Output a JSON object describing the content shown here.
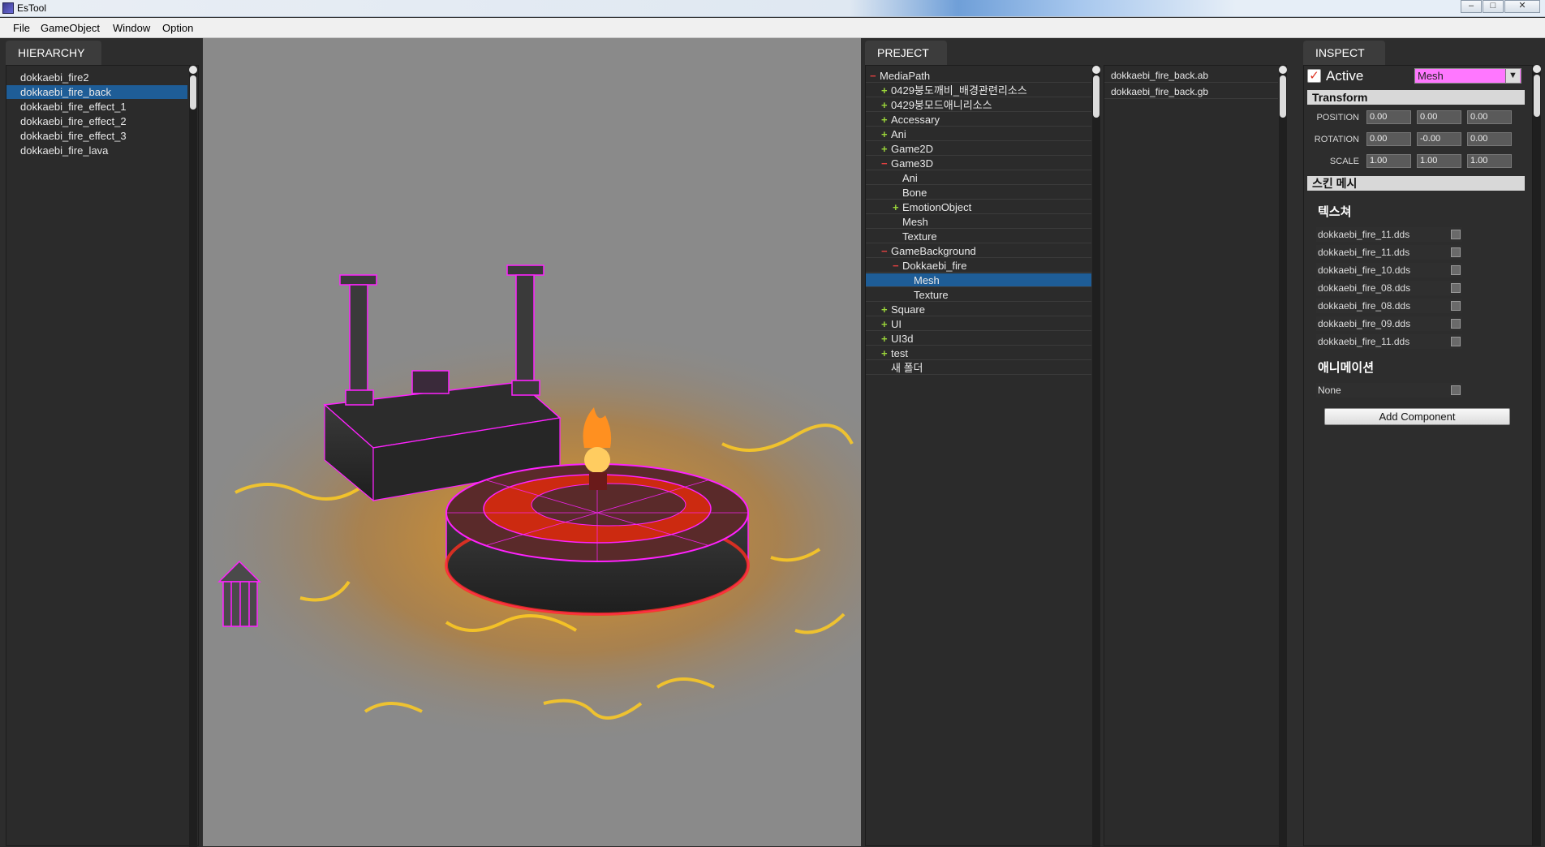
{
  "window": {
    "title": "EsTool",
    "controls": [
      "–",
      "□",
      "✕"
    ]
  },
  "menu": [
    "File",
    "GameObject",
    "Window",
    "Option"
  ],
  "hierarchy": {
    "tab": "HIERARCHY",
    "items": [
      {
        "label": "dokkaebi_fire2",
        "selected": false
      },
      {
        "label": "dokkaebi_fire_back",
        "selected": true
      },
      {
        "label": "dokkaebi_fire_effect_1",
        "selected": false
      },
      {
        "label": "dokkaebi_fire_effect_2",
        "selected": false
      },
      {
        "label": "dokkaebi_fire_effect_3",
        "selected": false
      },
      {
        "label": "dokkaebi_fire_lava",
        "selected": false
      }
    ]
  },
  "project": {
    "tab": "PREJECT",
    "tree": [
      {
        "label": "MediaPath",
        "marker": "minus",
        "depth": 0
      },
      {
        "label": "0429붕도깨비_배경관련리소스",
        "marker": "plus",
        "depth": 1
      },
      {
        "label": "0429붕모드애니리소스",
        "marker": "plus",
        "depth": 1
      },
      {
        "label": "Accessary",
        "marker": "plus",
        "depth": 1
      },
      {
        "label": "Ani",
        "marker": "plus",
        "depth": 1
      },
      {
        "label": "Game2D",
        "marker": "plus",
        "depth": 1
      },
      {
        "label": "Game3D",
        "marker": "minus",
        "depth": 1
      },
      {
        "label": "Ani",
        "marker": "",
        "depth": 2
      },
      {
        "label": "Bone",
        "marker": "",
        "depth": 2
      },
      {
        "label": "EmotionObject",
        "marker": "plus",
        "depth": 2
      },
      {
        "label": "Mesh",
        "marker": "",
        "depth": 2
      },
      {
        "label": "Texture",
        "marker": "",
        "depth": 2
      },
      {
        "label": "GameBackground",
        "marker": "minus",
        "depth": 1
      },
      {
        "label": "Dokkaebi_fire",
        "marker": "minus",
        "depth": 2
      },
      {
        "label": "Mesh",
        "marker": "",
        "depth": 3,
        "selected": true
      },
      {
        "label": "Texture",
        "marker": "",
        "depth": 3
      },
      {
        "label": "Square",
        "marker": "plus",
        "depth": 1
      },
      {
        "label": "UI",
        "marker": "plus",
        "depth": 1
      },
      {
        "label": "UI3d",
        "marker": "plus",
        "depth": 1
      },
      {
        "label": "test",
        "marker": "plus",
        "depth": 1
      },
      {
        "label": "새 폴더",
        "marker": "",
        "depth": 1
      }
    ],
    "files": [
      "dokkaebi_fire_back.ab",
      "dokkaebi_fire_back.gb"
    ]
  },
  "inspect": {
    "tab": "INSPECT",
    "active_label": "Active",
    "active_checked": true,
    "type_value": "Mesh",
    "transform_header": "Transform",
    "rows": [
      {
        "label": "POSITION",
        "values": [
          "0.00",
          "0.00",
          "0.00"
        ]
      },
      {
        "label": "ROTATION",
        "values": [
          "0.00",
          "-0.00",
          "0.00"
        ]
      },
      {
        "label": "SCALE",
        "values": [
          "1.00",
          "1.00",
          "1.00"
        ]
      }
    ],
    "skin_header": "스킨 메시",
    "texture_title": "텍스쳐",
    "textures": [
      "dokkaebi_fire_11.dds",
      "dokkaebi_fire_11.dds",
      "dokkaebi_fire_10.dds",
      "dokkaebi_fire_08.dds",
      "dokkaebi_fire_08.dds",
      "dokkaebi_fire_09.dds",
      "dokkaebi_fire_11.dds"
    ],
    "animation_title": "애니메이션",
    "animation_value": "None",
    "add_component": "Add Component"
  },
  "colors": {
    "selection": "#1e5d97",
    "wireframe": "#ff22ff",
    "accent_pink": "#ff77ff"
  }
}
